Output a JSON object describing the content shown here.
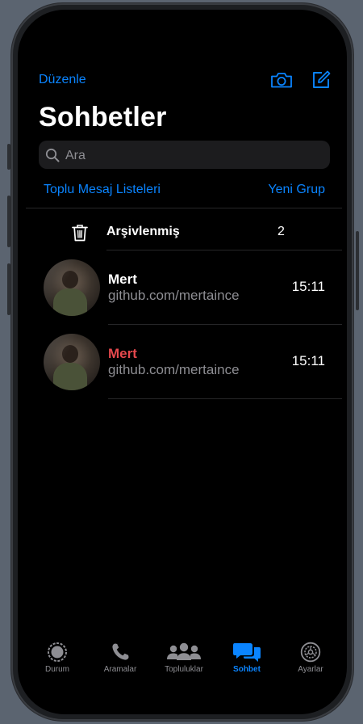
{
  "header": {
    "edit_label": "Düzenle",
    "title": "Sohbetler"
  },
  "search": {
    "placeholder": "Ara",
    "value": ""
  },
  "links": {
    "broadcast": "Toplu Mesaj Listeleri",
    "new_group": "Yeni Grup"
  },
  "archived": {
    "label": "Arşivlenmiş",
    "count": "2"
  },
  "chats": [
    {
      "name": "Mert",
      "preview": "github.com/mertaince",
      "time": "15:11",
      "name_color": "#ffffff"
    },
    {
      "name": "Mert",
      "preview": "github.com/mertaince",
      "time": "15:11",
      "name_color": "#e5484d"
    }
  ],
  "tabs": [
    {
      "label": "Durum",
      "icon": "status-icon",
      "active": false
    },
    {
      "label": "Aramalar",
      "icon": "phone-icon",
      "active": false
    },
    {
      "label": "Topluluklar",
      "icon": "communities-icon",
      "active": false
    },
    {
      "label": "Sohbet",
      "icon": "chats-icon",
      "active": true
    },
    {
      "label": "Ayarlar",
      "icon": "settings-icon",
      "active": false
    }
  ],
  "colors": {
    "accent": "#0a84ff",
    "background": "#000000",
    "muted_text": "#8e8e93",
    "highlight_name": "#e5484d"
  }
}
